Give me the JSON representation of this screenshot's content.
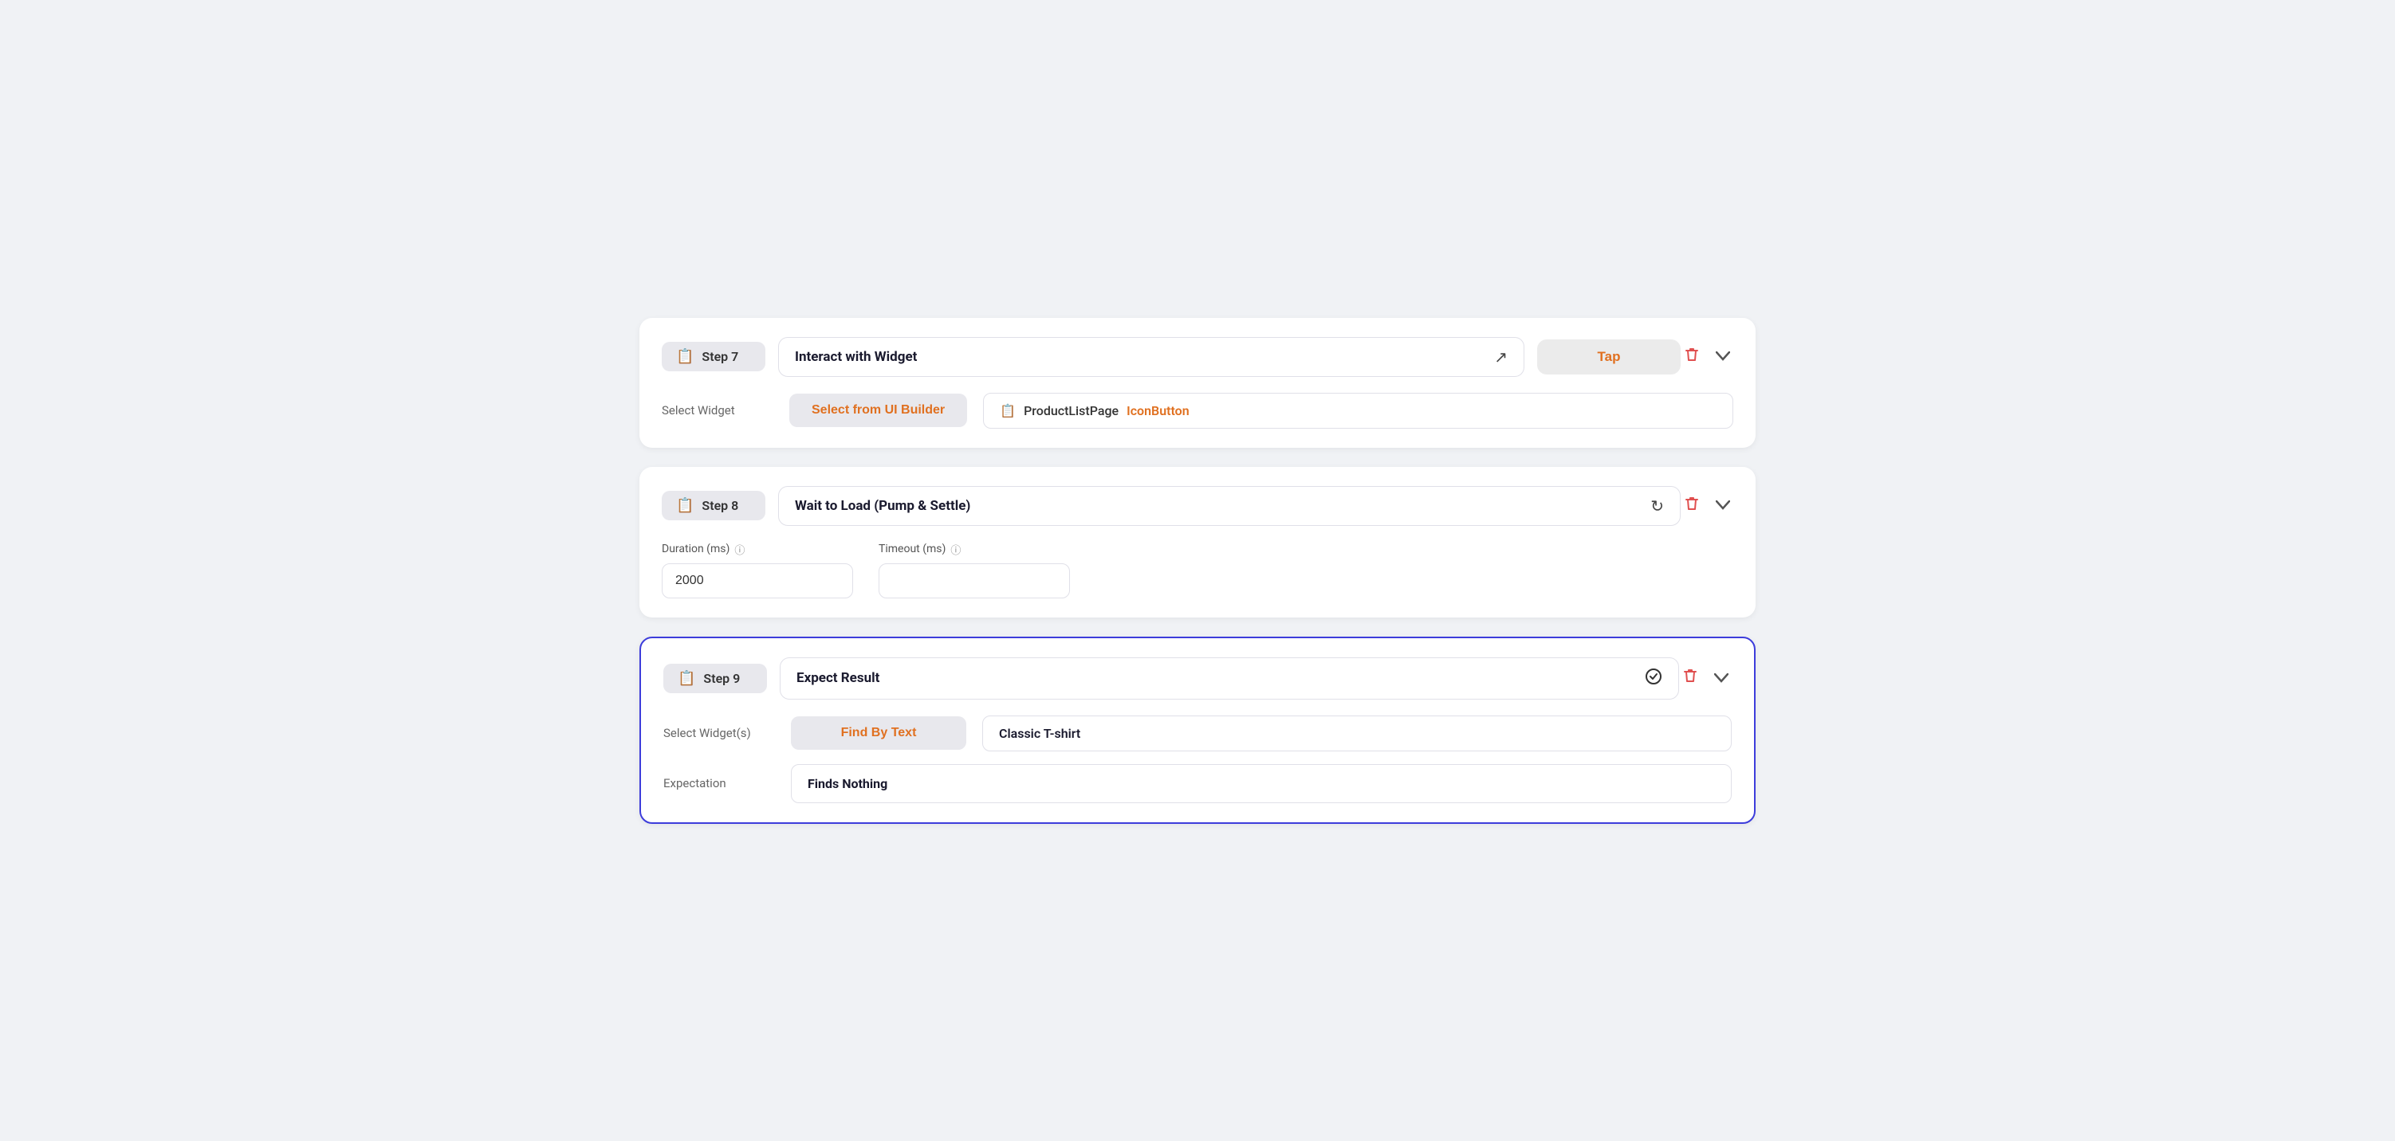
{
  "steps": [
    {
      "id": "step7",
      "badge_label": "Step 7",
      "title": "Interact with Widget",
      "title_icon": "cursor-icon",
      "action_btn_label": "Tap",
      "active": false,
      "fields": [
        {
          "type": "widget_select",
          "label": "Select Widget",
          "btn_label": "Select from UI Builder",
          "widget_page": "ProductListPage",
          "widget_name": "IconButton"
        }
      ]
    },
    {
      "id": "step8",
      "badge_label": "Step 8",
      "title": "Wait to Load (Pump & Settle)",
      "title_icon": "reload-icon",
      "action_btn_label": null,
      "active": false,
      "fields": [
        {
          "type": "duration",
          "duration_label": "Duration (ms)",
          "duration_value": "2000",
          "timeout_label": "Timeout (ms)",
          "timeout_value": ""
        }
      ]
    },
    {
      "id": "step9",
      "badge_label": "Step 9",
      "title": "Expect Result",
      "title_icon": "check-circle-icon",
      "action_btn_label": null,
      "active": true,
      "fields": [
        {
          "type": "find_by_text",
          "label": "Select Widget(s)",
          "btn_label": "Find By Text",
          "text_value": "Classic T-shirt"
        },
        {
          "type": "expectation",
          "label": "Expectation",
          "value": "Finds Nothing"
        }
      ]
    }
  ],
  "icons": {
    "step_badge": "📋",
    "cursor": "↗",
    "reload": "↺",
    "check_circle": "✓",
    "delete": "🗑",
    "chevron": "∨",
    "info": "ⓘ",
    "widget_ref": "📋"
  }
}
